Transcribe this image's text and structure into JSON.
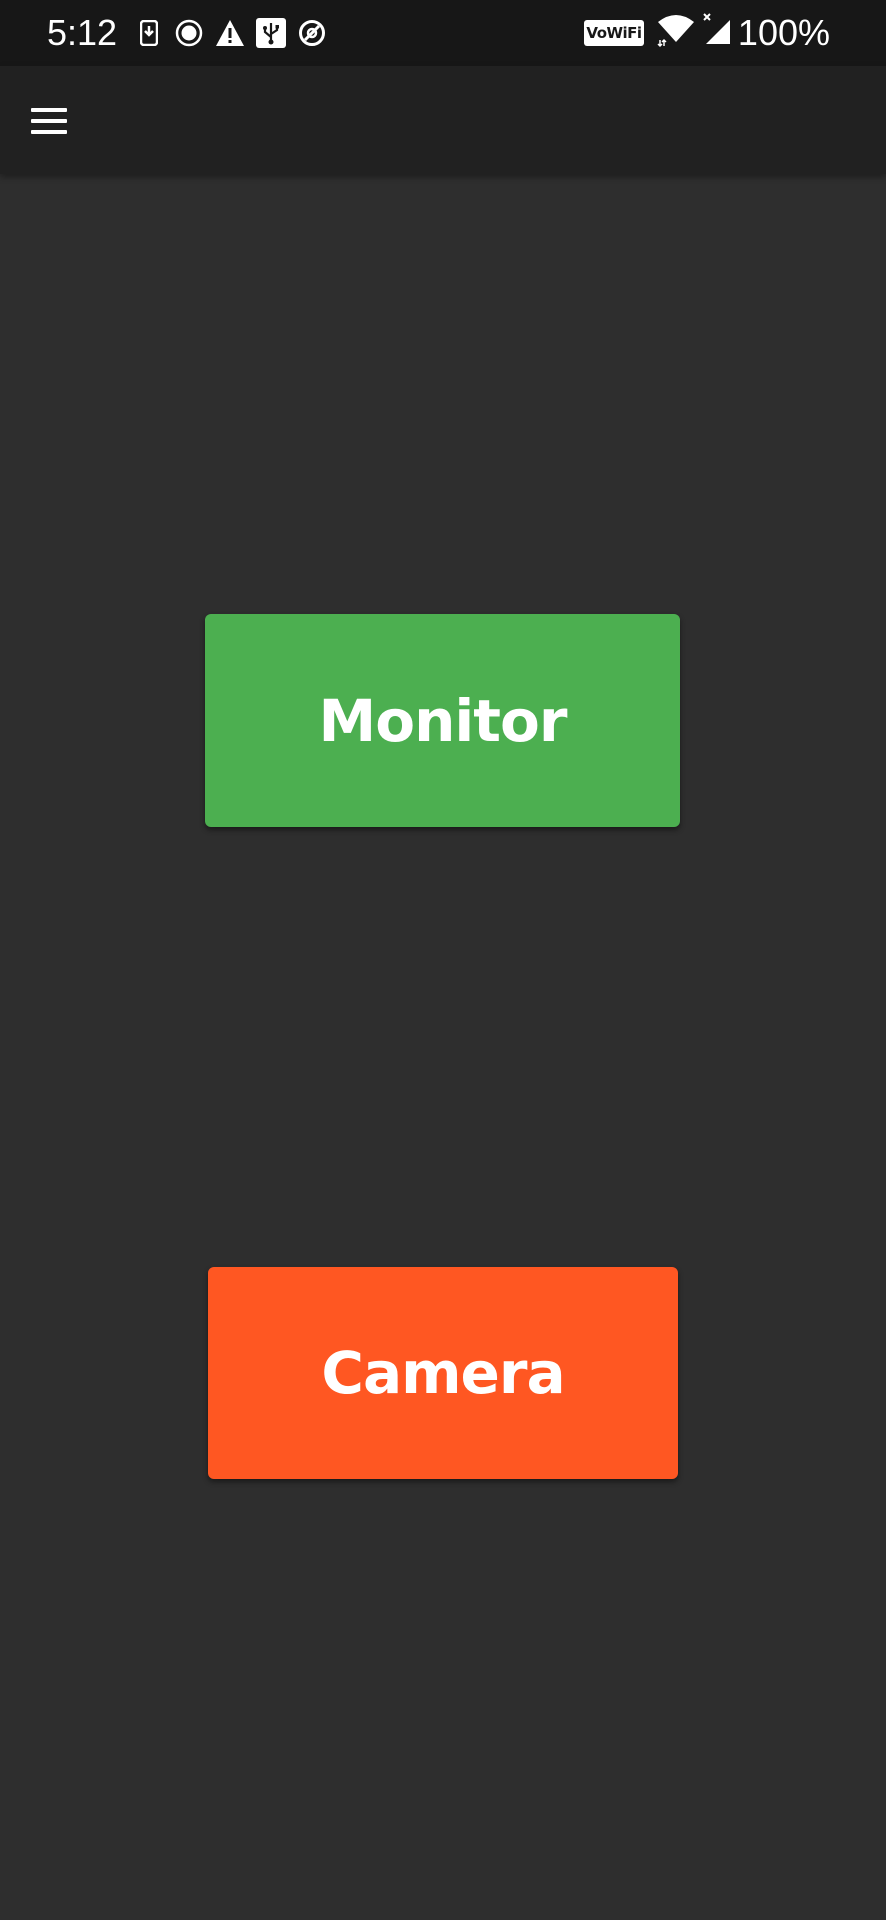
{
  "status_bar": {
    "time": "5:12",
    "vowifi_label": "VoWiFi",
    "battery_percent": "100%",
    "left_icons": [
      "download-icon",
      "record-icon",
      "warning-icon",
      "usb-icon",
      "data-saver-icon"
    ],
    "right_icons": [
      "wifi-icon",
      "signal-icon"
    ]
  },
  "app_bar": {
    "menu_icon": "hamburger-menu-icon"
  },
  "main": {
    "monitor_label": "Monitor",
    "camera_label": "Camera"
  },
  "colors": {
    "background": "#2e2e2e",
    "status_bar": "#171717",
    "app_bar": "#212121",
    "monitor_button": "#4caf50",
    "camera_button": "#ff5722",
    "text": "#ffffff"
  }
}
